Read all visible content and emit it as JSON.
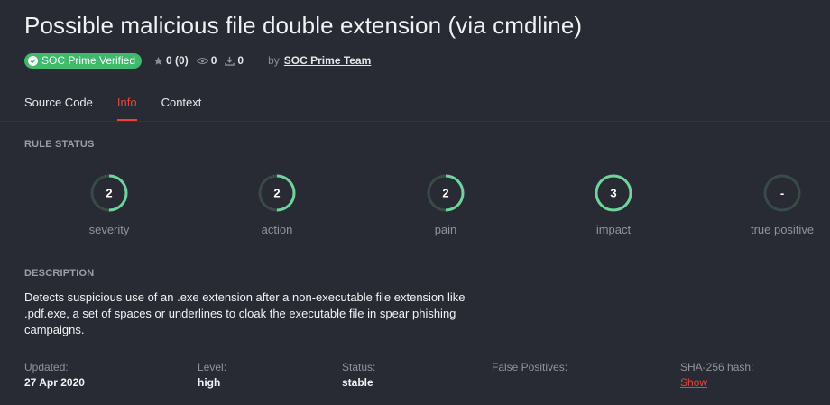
{
  "header": {
    "title": "Possible malicious file double extension (via cmdline)",
    "badge": "SOC Prime Verified",
    "rating": "0 (0)",
    "views": "0",
    "downloads": "0",
    "by_label": "by",
    "author": "SOC Prime Team"
  },
  "tabs": [
    {
      "label": "Source Code",
      "active": false
    },
    {
      "label": "Info",
      "active": true
    },
    {
      "label": "Context",
      "active": false
    }
  ],
  "rule_status": {
    "heading": "RULE STATUS",
    "items": [
      {
        "value": "2",
        "label": "severity",
        "fill": 0.5
      },
      {
        "value": "2",
        "label": "action",
        "fill": 0.5
      },
      {
        "value": "2",
        "label": "pain",
        "fill": 0.5
      },
      {
        "value": "3",
        "label": "impact",
        "fill": 1.0
      },
      {
        "value": "-",
        "label": "true positive",
        "fill": 0.0
      }
    ]
  },
  "description": {
    "heading": "DESCRIPTION",
    "text": "Detects suspicious use of an .exe extension after a non-executable file extension like .pdf.exe, a set of spaces or underlines to cloak the executable file in spear phishing campaigns."
  },
  "info": {
    "updated_label": "Updated:",
    "updated": "27 Apr 2020",
    "level_label": "Level:",
    "level": "high",
    "status_label": "Status:",
    "status": "stable",
    "fp_label": "False Positives:",
    "sha_label": "SHA-256 hash:",
    "sha_link": "Show"
  },
  "colors": {
    "background": "#282b33",
    "accent_red": "#e8433a",
    "gauge_fill": "#6fd39c",
    "gauge_track": "#3a4a48",
    "badge_green": "#3fb96b"
  }
}
